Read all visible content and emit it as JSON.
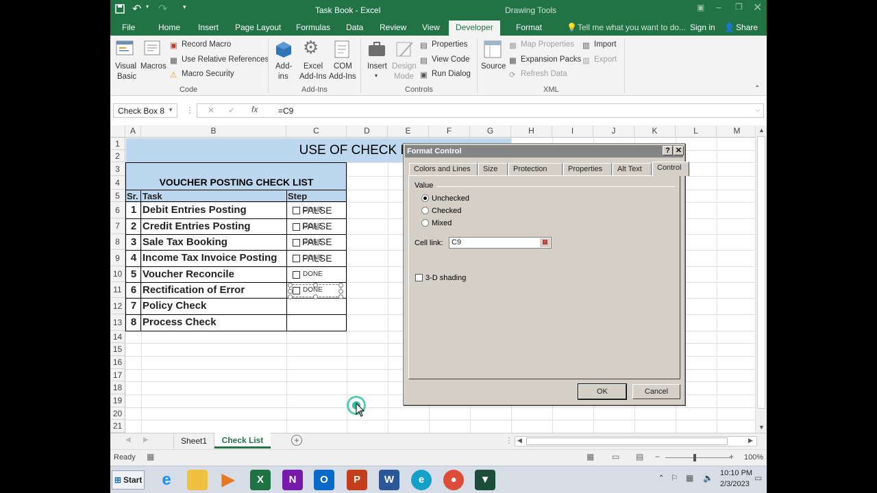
{
  "titlebar": {
    "title": "Task Book  -  Excel",
    "context": "Drawing Tools"
  },
  "tabs": {
    "file": "File",
    "home": "Home",
    "insert": "Insert",
    "page_layout": "Page Layout",
    "formulas": "Formulas",
    "data": "Data",
    "review": "Review",
    "view": "View",
    "developer": "Developer",
    "format": "Format",
    "tell": "Tell me what you want to do...",
    "signin": "Sign in",
    "share": "Share"
  },
  "ribbon": {
    "visual_basic": "Visual\nBasic",
    "visual_basic_1": "Visual",
    "visual_basic_2": "Basic",
    "macros": "Macros",
    "record_macro": "Record Macro",
    "relative_refs": "Use Relative References",
    "macro_security": "Macro Security",
    "group_code": "Code",
    "addins_1": "Add-",
    "addins_2": "ins",
    "excel_addins_1": "Excel",
    "excel_addins_2": "Add-Ins",
    "com_addins_1": "COM",
    "com_addins_2": "Add-Ins",
    "group_addins": "Add-Ins",
    "insert": "Insert",
    "design_mode_1": "Design",
    "design_mode_2": "Mode",
    "properties": "Properties",
    "view_code": "View Code",
    "run_dialog": "Run Dialog",
    "group_controls": "Controls",
    "source": "Source",
    "map_properties": "Map Properties",
    "expansion_packs": "Expansion Packs",
    "refresh_data": "Refresh Data",
    "import": "Import",
    "export": "Export",
    "group_xml": "XML"
  },
  "formula_bar": {
    "name_box": "Check Box 8",
    "formula": "=C9"
  },
  "columns": [
    "A",
    "B",
    "C",
    "D",
    "E",
    "F",
    "G",
    "H",
    "I",
    "J",
    "K",
    "L",
    "M"
  ],
  "rows": [
    "1",
    "2",
    "3",
    "4",
    "5",
    "6",
    "7",
    "8",
    "9",
    "10",
    "11",
    "12",
    "13",
    "14",
    "15",
    "16",
    "17",
    "18",
    "19",
    "20",
    "21"
  ],
  "sheet": {
    "title": "USE OF CHECK BOXES IN CHECK",
    "subtitle": "VOUCHER POSTING CHECK LIST",
    "headers": {
      "sr": "Sr.",
      "task": "Task",
      "step": "Step"
    },
    "items": [
      {
        "sr": "1",
        "task": "Debit Entries Posting",
        "value": "FALSE",
        "caption": "DONE"
      },
      {
        "sr": "2",
        "task": "Credit Entries Posting",
        "value": "FALSE",
        "caption": "DONE"
      },
      {
        "sr": "3",
        "task": "Sale Tax Booking",
        "value": "FALSE",
        "caption": "DONE"
      },
      {
        "sr": "4",
        "task": "Income Tax Invoice Posting",
        "value": "FALSE",
        "caption": "DONE"
      },
      {
        "sr": "5",
        "task": "Voucher Reconcile",
        "value": "",
        "caption": "DONE"
      },
      {
        "sr": "6",
        "task": "Rectification of Error",
        "value": "",
        "caption": "DONE"
      },
      {
        "sr": "7",
        "task": "Policy Check",
        "value": "",
        "caption": ""
      },
      {
        "sr": "8",
        "task": "Process Check",
        "value": "",
        "caption": ""
      }
    ]
  },
  "sheet_tabs": {
    "sheet1": "Sheet1",
    "active": "Check List"
  },
  "status": {
    "ready": "Ready",
    "zoom": "100%"
  },
  "taskbar": {
    "start": "Start",
    "time": "10:10 PM",
    "date": "2/3/2023"
  },
  "dialog": {
    "title": "Format Control",
    "tabs": [
      "Colors and Lines",
      "Size",
      "Protection",
      "Properties",
      "Alt Text",
      "Control"
    ],
    "value_label": "Value",
    "unchecked": "Unchecked",
    "checked": "Checked",
    "mixed": "Mixed",
    "cell_link_label": "Cell link:",
    "cell_link": "C9",
    "shading": "3-D shading",
    "ok": "OK",
    "cancel": "Cancel",
    "selected_value": "Unchecked"
  },
  "colors": {
    "excel_green": "#217346",
    "header_fill": "#bdd7ee",
    "dialog_gray": "#d4d0c8"
  }
}
